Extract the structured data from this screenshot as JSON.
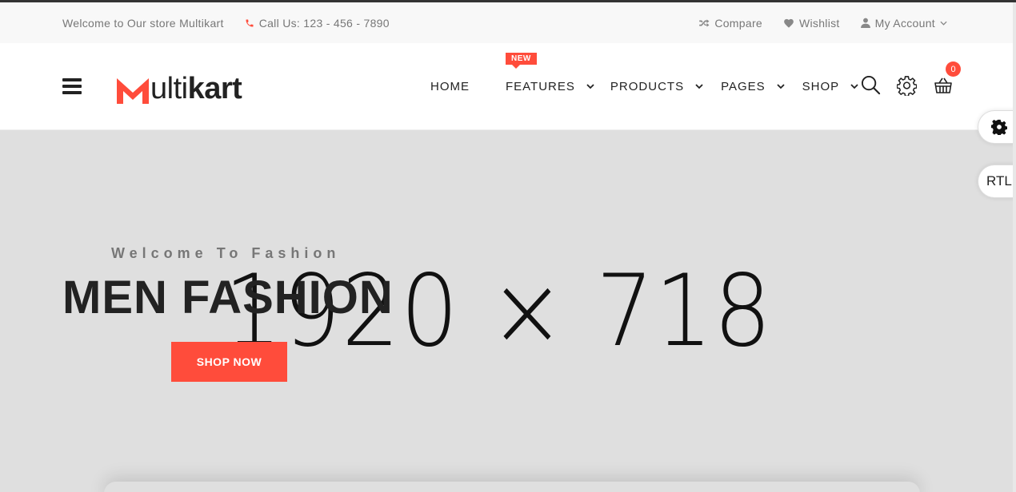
{
  "topbar": {
    "welcome": "Welcome to Our store Multikart",
    "phone": "Call Us: 123 - 456 - 7890",
    "compare": "Compare",
    "wishlist": "Wishlist",
    "account": "My Account"
  },
  "header": {
    "logo_letter": "M",
    "logo_thin": "ulti",
    "logo_bold": "kart",
    "nav": [
      {
        "label": "HOME"
      },
      {
        "label": "FEATURES",
        "badge": "NEW"
      },
      {
        "label": "PRODUCTS"
      },
      {
        "label": "PAGES"
      },
      {
        "label": "SHOP"
      }
    ],
    "cart_count": "0"
  },
  "hero": {
    "placeholder": "1920 × 718",
    "subtitle": "Welcome To Fashion",
    "headline": "MEN FASHION",
    "button": "SHOP NOW"
  },
  "side": {
    "rtl": "RTL"
  },
  "colors": {
    "accent": "#ff4c3b",
    "hero_bg": "#dfdfdf",
    "topbar_bg": "#f8f8f8"
  },
  "icons": [
    "phone-icon",
    "shuffle-icon",
    "heart-icon",
    "user-icon",
    "chevron-down-icon",
    "hamburger-icon",
    "search-icon",
    "gear-icon",
    "basket-icon"
  ]
}
